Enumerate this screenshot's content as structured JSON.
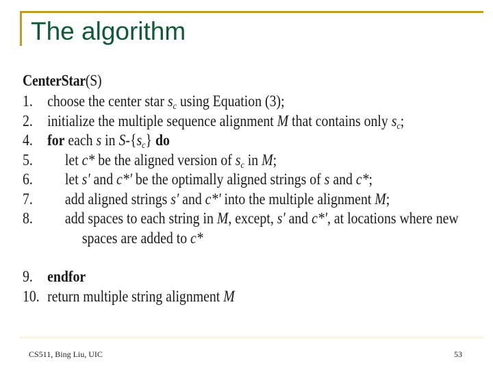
{
  "slide": {
    "title": "The algorithm",
    "accent_color": "#c49a26",
    "title_color": "#0e5a36"
  },
  "algorithm": {
    "name": "CenterStar",
    "param": "(S)",
    "steps": [
      {
        "num": "1.",
        "parts": [
          {
            "t": "choose the center star ",
            "s": ""
          },
          {
            "t": "s",
            "s": "it"
          },
          {
            "t": "c",
            "s": "sub"
          },
          {
            "t": " using Equation (3);",
            "s": ""
          }
        ]
      },
      {
        "num": "2.",
        "parts": [
          {
            "t": "initialize the multiple sequence alignment ",
            "s": ""
          },
          {
            "t": "M",
            "s": "it"
          },
          {
            "t": " that contains only ",
            "s": ""
          },
          {
            "t": "s",
            "s": "it"
          },
          {
            "t": "c",
            "s": "sub"
          },
          {
            "t": ";",
            "s": ""
          }
        ]
      },
      {
        "num": "4.",
        "parts": [
          {
            "t": "for",
            "s": "kw"
          },
          {
            "t": " each ",
            "s": ""
          },
          {
            "t": "s",
            "s": "it"
          },
          {
            "t": " in ",
            "s": ""
          },
          {
            "t": "S",
            "s": "it"
          },
          {
            "t": "-{",
            "s": ""
          },
          {
            "t": "s",
            "s": "it"
          },
          {
            "t": "c",
            "s": "sub"
          },
          {
            "t": "} ",
            "s": ""
          },
          {
            "t": "do",
            "s": "kw"
          }
        ]
      },
      {
        "num": "5.",
        "indent": true,
        "parts": [
          {
            "t": "let ",
            "s": ""
          },
          {
            "t": "c*",
            "s": "it"
          },
          {
            "t": " be the aligned version of ",
            "s": ""
          },
          {
            "t": "s",
            "s": "it"
          },
          {
            "t": "c",
            "s": "sub"
          },
          {
            "t": " in ",
            "s": ""
          },
          {
            "t": "M",
            "s": "it"
          },
          {
            "t": ";",
            "s": ""
          }
        ]
      },
      {
        "num": "6.",
        "indent": true,
        "parts": [
          {
            "t": "let ",
            "s": ""
          },
          {
            "t": "s'",
            "s": "it"
          },
          {
            "t": " and ",
            "s": ""
          },
          {
            "t": "c*'",
            "s": "it"
          },
          {
            "t": " be the optimally aligned strings of ",
            "s": ""
          },
          {
            "t": "s",
            "s": "it"
          },
          {
            "t": " and ",
            "s": ""
          },
          {
            "t": "c*",
            "s": "it"
          },
          {
            "t": ";",
            "s": ""
          }
        ]
      },
      {
        "num": "7.",
        "indent": true,
        "parts": [
          {
            "t": "add aligned strings ",
            "s": ""
          },
          {
            "t": "s'",
            "s": "it"
          },
          {
            "t": " and ",
            "s": ""
          },
          {
            "t": "c*'",
            "s": "it"
          },
          {
            "t": " into the multiple alignment ",
            "s": ""
          },
          {
            "t": "M",
            "s": "it"
          },
          {
            "t": ";",
            "s": ""
          }
        ]
      },
      {
        "num": "8.",
        "indent": true,
        "parts": [
          {
            "t": "add spaces to each string in ",
            "s": ""
          },
          {
            "t": "M",
            "s": "it"
          },
          {
            "t": ", except, ",
            "s": ""
          },
          {
            "t": "s'",
            "s": "it"
          },
          {
            "t": " and ",
            "s": ""
          },
          {
            "t": "c*'",
            "s": "it"
          },
          {
            "t": ", at locations where new",
            "s": ""
          }
        ]
      },
      {
        "num": "",
        "cont": true,
        "parts": [
          {
            "t": "spaces are added to ",
            "s": ""
          },
          {
            "t": "c*",
            "s": "it"
          }
        ]
      },
      {
        "num": "9.",
        "gap": true,
        "parts": [
          {
            "t": "endfor",
            "s": "kw"
          }
        ]
      },
      {
        "num": "10.",
        "parts": [
          {
            "t": "return multiple string alignment ",
            "s": ""
          },
          {
            "t": "M",
            "s": "it"
          }
        ]
      }
    ]
  },
  "footer": {
    "left": "CS511, Bing Liu, UIC",
    "page_number": "53"
  }
}
